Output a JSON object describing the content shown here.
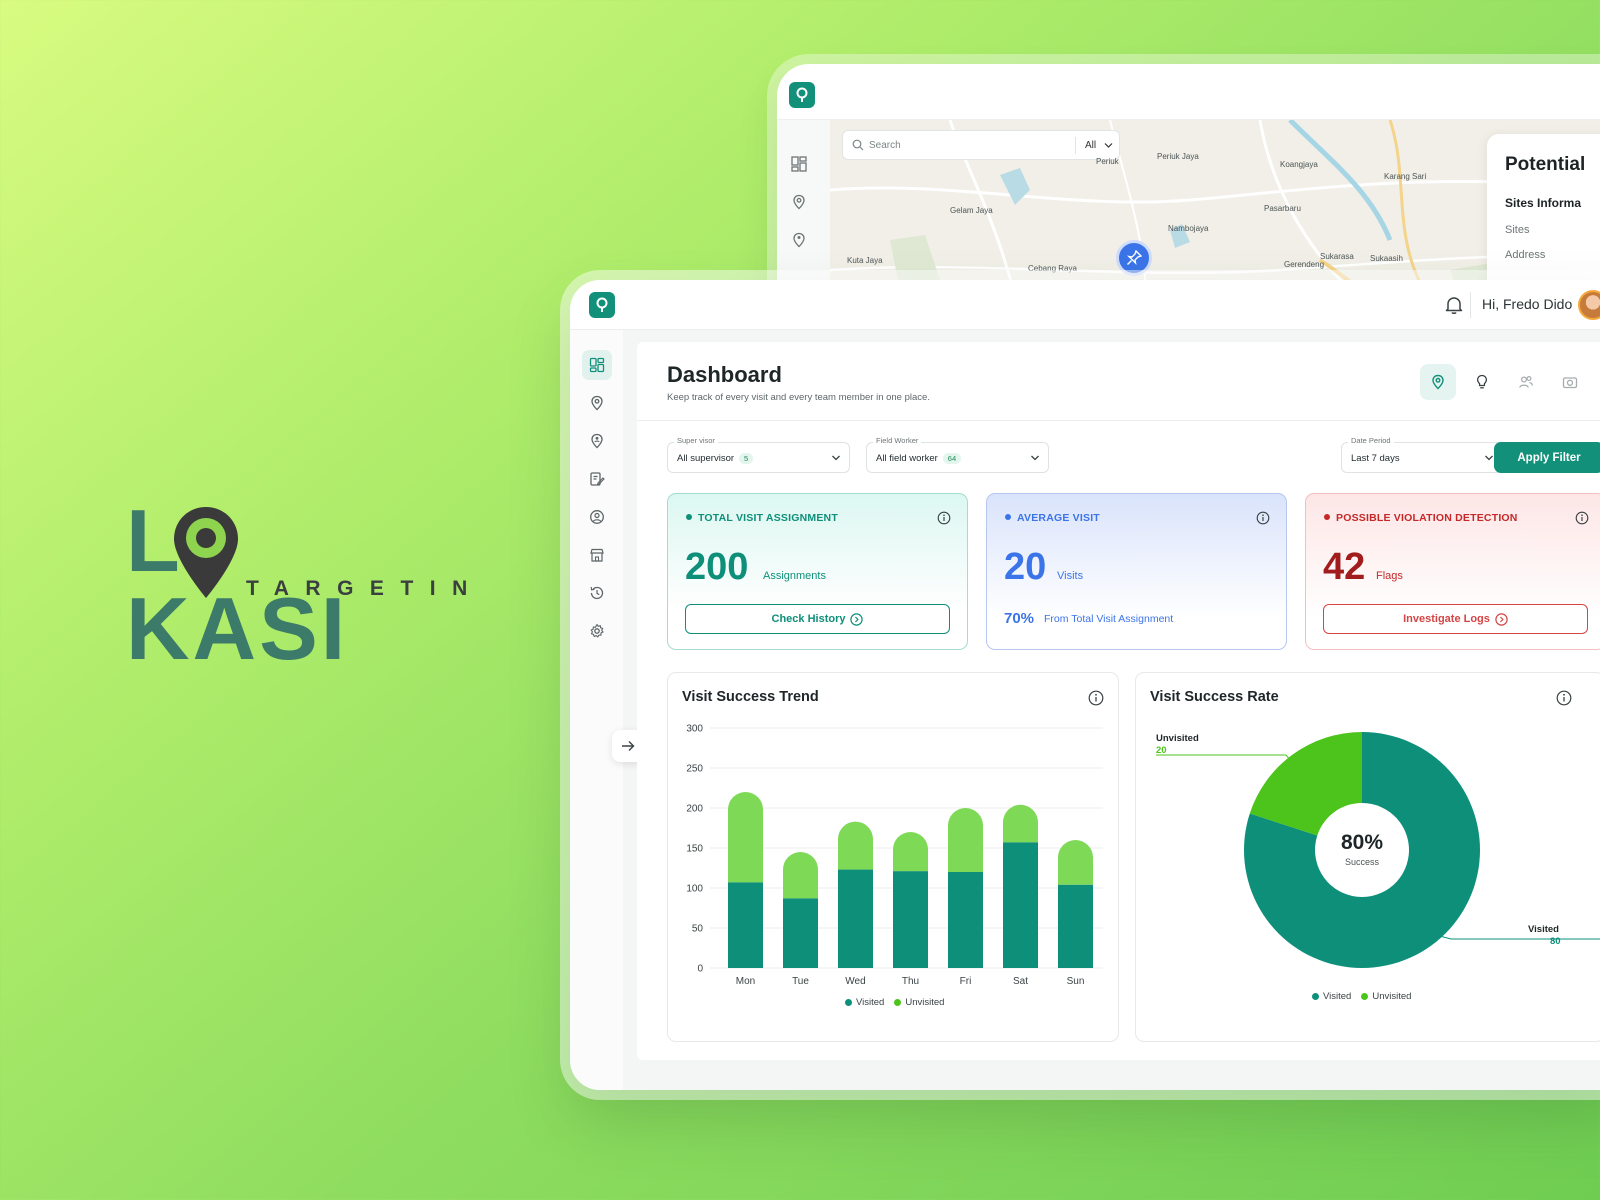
{
  "brand": {
    "logo_text": "LOKASI",
    "logo_sub": "TARGETIN"
  },
  "colors": {
    "primary": "#12907a",
    "visited": "#0e8f7a",
    "unvisited": "#4cc41b",
    "unvisited_bar": "#7ed957",
    "blue": "#3b74e8",
    "red": "#b3261e"
  },
  "map_window": {
    "search_placeholder": "Search",
    "search_scope": "All",
    "places": [
      "Periuk Jaya",
      "Koangjaya",
      "Karang Sari",
      "Gelam Jaya",
      "Pasarbaru",
      "Nambojaya",
      "Kuta Jaya",
      "Cebang Raya",
      "Sukarasa",
      "Gerendeng",
      "Sukaasih",
      "Periuk"
    ],
    "panel": {
      "title": "Potential",
      "section": "Sites Informa",
      "rows": [
        "Sites",
        "Address"
      ]
    }
  },
  "header": {
    "greeting": "Hi, Fredo Dido"
  },
  "sidebar": {
    "items": [
      {
        "name": "dashboard",
        "icon": "grid-icon",
        "active": true
      },
      {
        "name": "locations",
        "icon": "map-pin-icon",
        "active": false
      },
      {
        "name": "sites",
        "icon": "location-user-icon",
        "active": false
      },
      {
        "name": "reports",
        "icon": "edit-document-icon",
        "active": false
      },
      {
        "name": "users",
        "icon": "user-circle-icon",
        "active": false
      },
      {
        "name": "stores",
        "icon": "store-icon",
        "active": false
      },
      {
        "name": "history",
        "icon": "history-icon",
        "active": false
      },
      {
        "name": "settings",
        "icon": "gear-icon",
        "active": false
      }
    ]
  },
  "dashboard": {
    "title": "Dashboard",
    "subtitle": "Keep track of every visit and every team member in one place."
  },
  "filters": {
    "supervisor": {
      "label": "Super visor",
      "value": "All supervisor",
      "badge": "5"
    },
    "field_worker": {
      "label": "Field Worker",
      "value": "All field worker",
      "badge": "64"
    },
    "date_period": {
      "label": "Date Period",
      "value": "Last 7 days"
    },
    "apply_label": "Apply Filter"
  },
  "cards": {
    "total": {
      "title": "TOTAL VISIT ASSIGNMENT",
      "value": "200",
      "unit": "Assignments",
      "button": "Check History"
    },
    "average": {
      "title": "AVERAGE VISIT",
      "value": "20",
      "unit": "Visits",
      "percent": "70%",
      "note": "From Total Visit Assignment"
    },
    "violation": {
      "title": "POSSIBLE VIOLATION DETECTION",
      "value": "42",
      "unit": "Flags",
      "button": "Investigate Logs"
    }
  },
  "trend_chart": {
    "title": "Visit Success Trend"
  },
  "rate_chart": {
    "title": "Visit Success Rate",
    "center_value": "80%",
    "center_label": "Success",
    "unvisited_label": "Unvisited",
    "unvisited_value": "20",
    "visited_label": "Visited",
    "visited_value": "80"
  },
  "chart_data": [
    {
      "type": "bar",
      "title": "Visit Success Trend",
      "stacked": true,
      "categories": [
        "Mon",
        "Tue",
        "Wed",
        "Thu",
        "Fri",
        "Sat",
        "Sun"
      ],
      "series": [
        {
          "name": "Visited",
          "values": [
            107,
            87,
            123,
            121,
            120,
            157,
            104
          ]
        },
        {
          "name": "Unvisited",
          "values": [
            113,
            58,
            60,
            49,
            80,
            47,
            56
          ]
        }
      ],
      "ylim": [
        0,
        300
      ],
      "yticks": [
        0,
        50,
        100,
        150,
        200,
        250,
        300
      ],
      "grid": true,
      "legend": "bottom"
    },
    {
      "type": "pie",
      "title": "Visit Success Rate",
      "donut": true,
      "categories": [
        "Visited",
        "Unvisited"
      ],
      "values": [
        80,
        20
      ],
      "legend": "bottom"
    }
  ]
}
